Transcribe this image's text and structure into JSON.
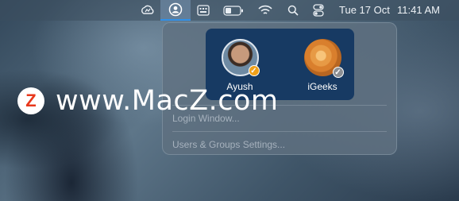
{
  "menubar": {
    "date": "Tue 17 Oct",
    "time": "11:41 AM",
    "icons": [
      "cloud-icon",
      "user-switcher-icon",
      "keyboard-icon",
      "battery-icon",
      "wifi-icon",
      "search-icon",
      "control-center-icon"
    ]
  },
  "menu": {
    "users": [
      {
        "name": "Ayush",
        "status": "checked-orange"
      },
      {
        "name": "iGeeks",
        "status": "checked-gray"
      }
    ],
    "login_window": "Login Window...",
    "settings": "Users & Groups Settings..."
  },
  "watermark": {
    "logo_letter": "Z",
    "text": "www.MacZ.com"
  }
}
